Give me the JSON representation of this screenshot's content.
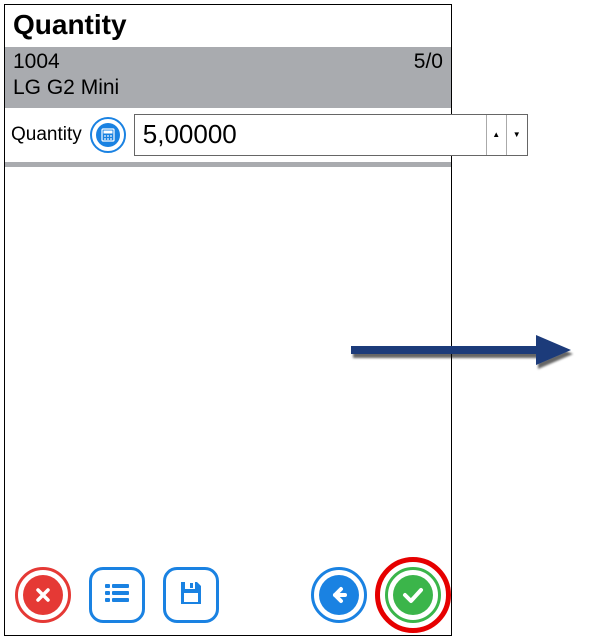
{
  "title": "Quantity",
  "item": {
    "code": "1004",
    "ratio": "5/0",
    "name": "LG G2 Mini"
  },
  "form": {
    "quantity_label": "Quantity",
    "quantity_value": "5,00000"
  },
  "icons": {
    "calculator": "calculator-icon",
    "cancel": "cancel-icon",
    "list": "list-icon",
    "save": "save-icon",
    "back": "back-icon",
    "confirm": "confirm-icon"
  },
  "colors": {
    "header_gray": "#a9abaf",
    "blue": "#1a82e2",
    "red": "#e53935",
    "green": "#3bb54a",
    "highlight": "#e60000",
    "arrow": "#1b3a7a"
  }
}
